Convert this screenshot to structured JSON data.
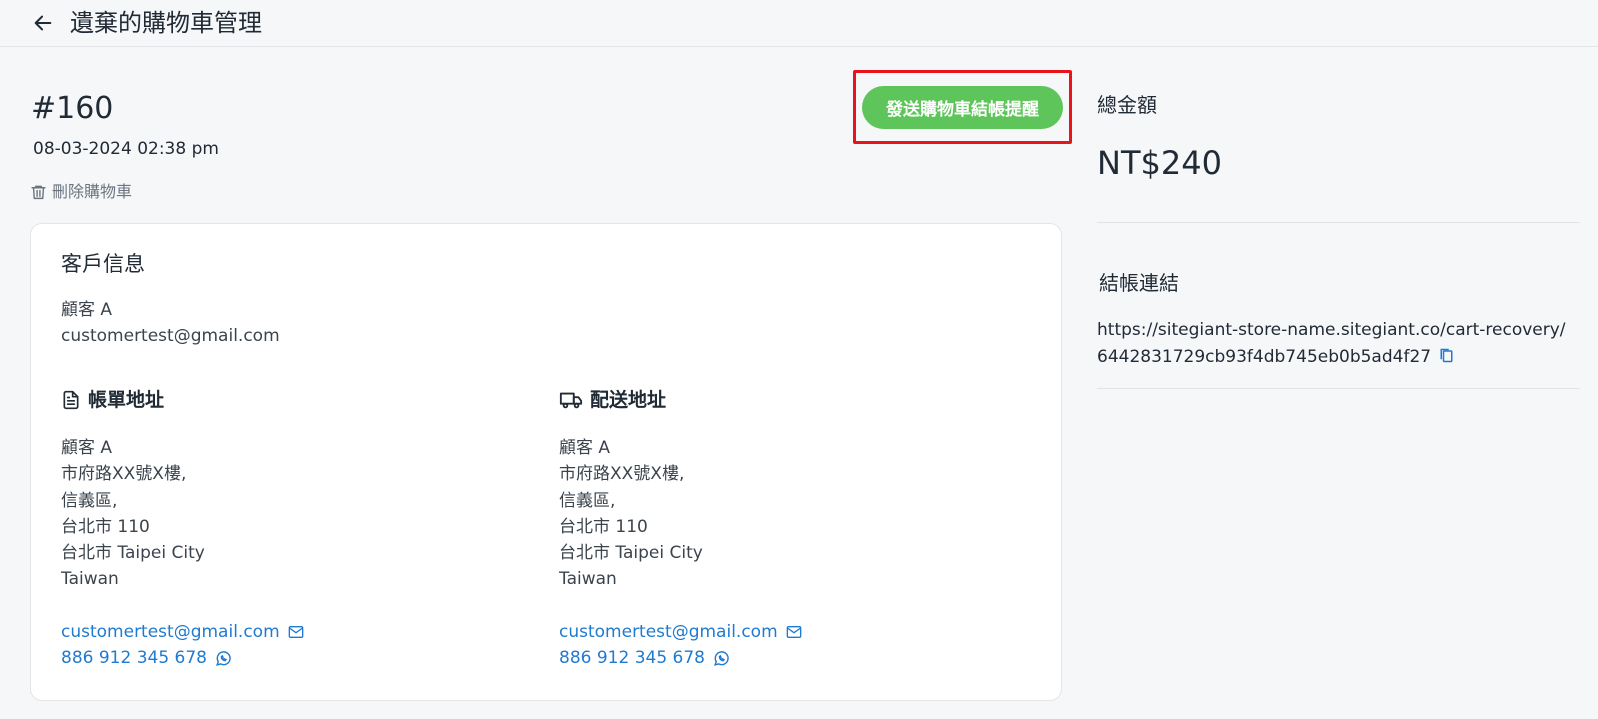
{
  "header": {
    "title": "遺棄的購物車管理"
  },
  "cart": {
    "id": "#160",
    "date": "08-03-2024 02:38 pm",
    "delete_label": "刪除購物車",
    "remind_button": "發送購物車結帳提醒"
  },
  "customer": {
    "section_title": "客戶信息",
    "name": "顧客 A",
    "email": "customertest@gmail.com"
  },
  "billing": {
    "title": "帳單地址",
    "name": "顧客 A",
    "line1": "市府路XX號X樓,",
    "line2": "信義區,",
    "line3": "台北市 110",
    "line4": "台北市 Taipei City",
    "country": "Taiwan",
    "email": "customertest@gmail.com",
    "phone": "886 912 345 678"
  },
  "shipping": {
    "title": "配送地址",
    "name": "顧客 A",
    "line1": "市府路XX號X樓,",
    "line2": "信義區,",
    "line3": "台北市 110",
    "line4": "台北市 Taipei City",
    "country": "Taiwan",
    "email": "customertest@gmail.com",
    "phone": "886 912 345 678"
  },
  "summary": {
    "total_label": "總金額",
    "total_value": "NT$240",
    "checkout_label": "結帳連結",
    "checkout_url": "https://sitegiant-store-name.sitegiant.co/cart-recovery/6442831729cb93f4db745eb0b5ad4f27"
  },
  "colors": {
    "accent_green": "#5ec55b",
    "link_blue": "#1f7ad1",
    "highlight_red": "#e8131b"
  },
  "icons": [
    "back-arrow-icon",
    "trash-icon",
    "document-icon",
    "truck-icon",
    "mail-icon",
    "whatsapp-icon",
    "copy-icon"
  ]
}
